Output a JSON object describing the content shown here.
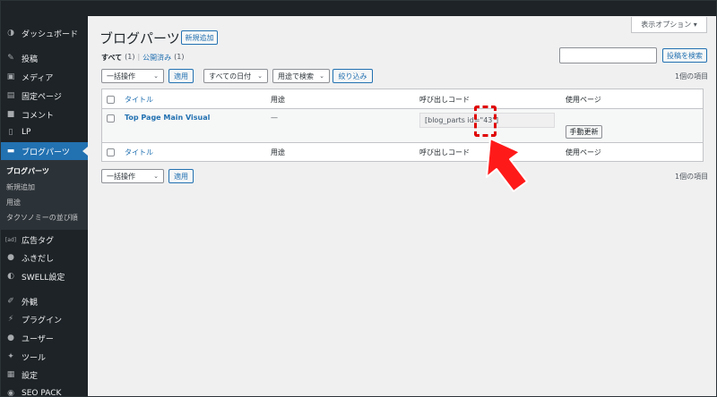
{
  "sidebar": {
    "items": [
      {
        "label": "ダッシュボード",
        "icon": "dashboard-icon",
        "glyph": "◑"
      },
      {
        "label": "投稿",
        "icon": "pin-icon",
        "glyph": "✎"
      },
      {
        "label": "メディア",
        "icon": "media-icon",
        "glyph": "▣"
      },
      {
        "label": "固定ページ",
        "icon": "page-icon",
        "glyph": "▤"
      },
      {
        "label": "コメント",
        "icon": "comment-icon",
        "glyph": "■"
      },
      {
        "label": "LP",
        "icon": "document-icon",
        "glyph": "▯"
      },
      {
        "label": "ブログパーツ",
        "icon": "blog-parts-icon",
        "glyph": "▬"
      },
      {
        "label": "広告タグ",
        "icon": "ad-icon",
        "glyph": "[ad]"
      },
      {
        "label": "ふきだし",
        "icon": "balloon-icon",
        "glyph": "●"
      },
      {
        "label": "SWELL設定",
        "icon": "swell-icon",
        "glyph": "◐"
      },
      {
        "label": "外観",
        "icon": "brush-icon",
        "glyph": "✐"
      },
      {
        "label": "プラグイン",
        "icon": "plugin-icon",
        "glyph": "⚡"
      },
      {
        "label": "ユーザー",
        "icon": "user-icon",
        "glyph": "●"
      },
      {
        "label": "ツール",
        "icon": "wrench-icon",
        "glyph": "✦"
      },
      {
        "label": "設定",
        "icon": "settings-icon",
        "glyph": "▦"
      },
      {
        "label": "SEO PACK",
        "icon": "seo-icon",
        "glyph": "◉"
      }
    ],
    "submenu": [
      "ブログパーツ",
      "新規追加",
      "用途",
      "タクソノミーの並び順"
    ]
  },
  "header": {
    "title": "ブログパーツ",
    "add_new": "新規追加",
    "screen_options": "表示オプション ▾"
  },
  "filters": {
    "all_label": "すべて",
    "all_count": "(1)",
    "separator": "|",
    "published_label": "公開済み",
    "published_count": "(1)"
  },
  "search": {
    "value": "",
    "button": "投稿を検索"
  },
  "bulk": {
    "select": "一括操作",
    "apply": "適用"
  },
  "date_filter": "すべての日付",
  "usage_filter": "用途で検索",
  "filter_button": "絞り込み",
  "item_count": "1個の項目",
  "table": {
    "columns": [
      "タイトル",
      "用途",
      "呼び出しコード",
      "使用ページ"
    ],
    "rows": [
      {
        "title": "Top Page Main Visual",
        "usage": "—",
        "code": "[blog_parts id=\"43\"]",
        "action": "手動更新"
      }
    ]
  },
  "annotation": {
    "highlight_color": "#e00000",
    "arrow_color": "#ff0000"
  }
}
